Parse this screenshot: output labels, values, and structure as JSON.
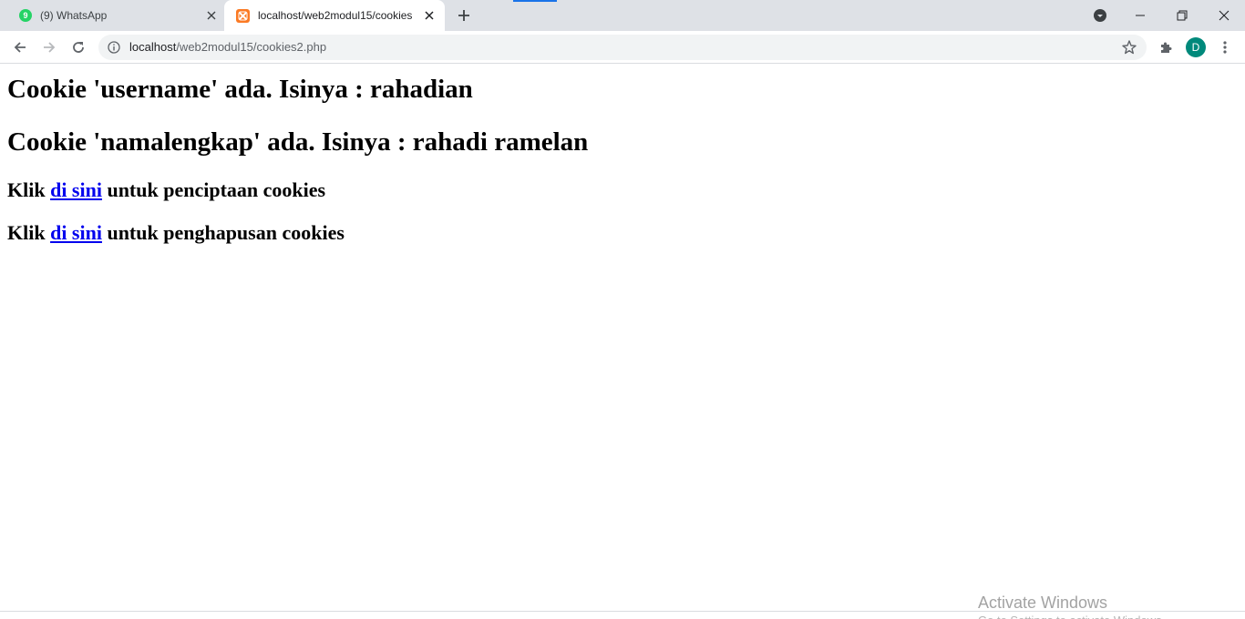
{
  "browser": {
    "tabs": [
      {
        "title": "(9) WhatsApp",
        "badge": "9",
        "active": false,
        "favicon": "whatsapp-icon"
      },
      {
        "title": "localhost/web2modul15/cookies",
        "active": true,
        "favicon": "xampp-icon"
      }
    ],
    "address_bar": {
      "host": "localhost",
      "path": "/web2modul15/cookies2.php"
    },
    "profile_initial": "D",
    "colors": {
      "avatar": "#00897b",
      "link": "#0000ee",
      "tabstrip": "#dee1e6",
      "omnibox": "#f1f3f4"
    }
  },
  "page": {
    "heading1": "Cookie 'username' ada. Isinya : rahadian",
    "heading2": "Cookie 'namalengkap' ada. Isinya : rahadi ramelan",
    "line1": {
      "prefix": "Klik ",
      "link": "di sini",
      "suffix": " untuk penciptaan cookies"
    },
    "line2": {
      "prefix": "Klik ",
      "link": "di sini",
      "suffix": " untuk penghapusan cookies"
    }
  },
  "watermark": {
    "title": "Activate Windows",
    "subtitle": "Go to Settings to activate Windows."
  }
}
